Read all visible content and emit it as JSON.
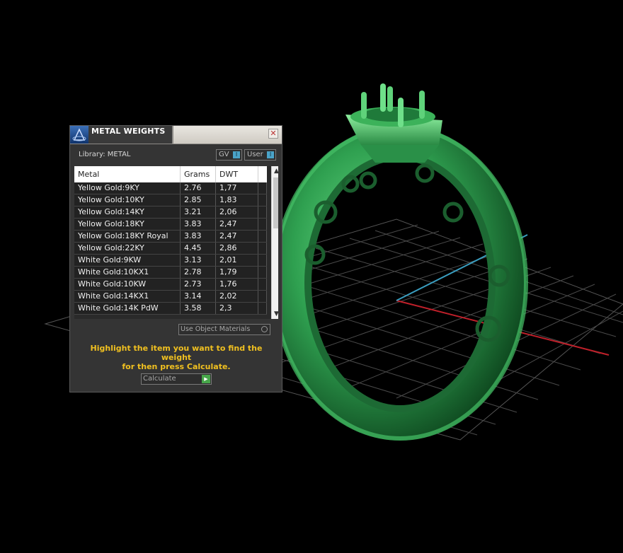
{
  "panel": {
    "title": "METAL WEIGHTS",
    "close_symbol": "✕",
    "library_label": "Library: METAL",
    "toggle_gv": "GV",
    "toggle_user": "User",
    "columns": {
      "metal": "Metal",
      "grams": "Grams",
      "dwt": "DWT"
    },
    "rows": [
      {
        "metal": "Yellow Gold:9KY",
        "grams": "2.76",
        "dwt": "1,77"
      },
      {
        "metal": "Yellow Gold:10KY",
        "grams": "2.85",
        "dwt": "1,83"
      },
      {
        "metal": "Yellow Gold:14KY",
        "grams": "3.21",
        "dwt": "2,06"
      },
      {
        "metal": "Yellow Gold:18KY",
        "grams": "3.83",
        "dwt": "2,47"
      },
      {
        "metal": "Yellow Gold:18KY Royal",
        "grams": "3.83",
        "dwt": "2,47"
      },
      {
        "metal": "Yellow Gold:22KY",
        "grams": "4.45",
        "dwt": "2,86"
      },
      {
        "metal": "White Gold:9KW",
        "grams": "3.13",
        "dwt": "2,01"
      },
      {
        "metal": "White Gold:10KX1",
        "grams": "2.78",
        "dwt": "1,79"
      },
      {
        "metal": "White Gold:10KW",
        "grams": "2.73",
        "dwt": "1,76"
      },
      {
        "metal": "White Gold:14KX1",
        "grams": "3.14",
        "dwt": "2,02"
      },
      {
        "metal": "White Gold:14K PdW",
        "grams": "3.58",
        "dwt": "2,3"
      }
    ],
    "use_object_materials_label": "Use Object Materials",
    "instruction_line1": "Highlight the item you want to find the weight",
    "instruction_line2": "for then press Calculate.",
    "calculate_label": "Calculate"
  },
  "scene": {
    "ring_color": "#2fa050",
    "grid_color": "#5a5a5a",
    "axis_x_color": "#c0202a",
    "axis_z_color": "#3a9ec0",
    "background": "#000000"
  }
}
